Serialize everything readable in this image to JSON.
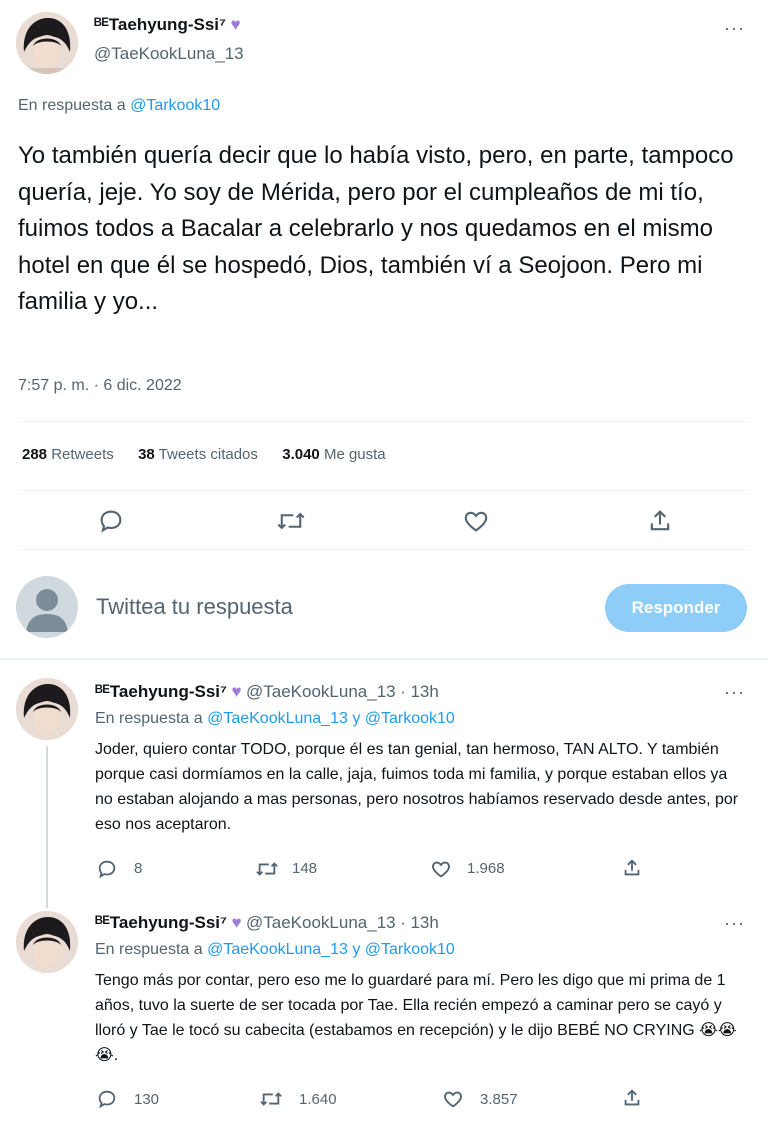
{
  "main_tweet": {
    "author_name": "ᴮᴱTaehyung-Ssi⁷",
    "handle": "@TaeKookLuna_13",
    "reply_prefix": "En respuesta a",
    "reply_to": "@Tarkook10",
    "text": "Yo también quería decir que lo había visto, pero, en parte, tampoco quería, jeje. Yo soy de Mérida, pero por el cumpleaños de mi tío, fuimos todos a Bacalar a celebrarlo y nos quedamos en el mismo hotel en que él se hospedó, Dios, también ví a Seojoon. Pero mi familia y yo...",
    "timestamp": "7:57 p. m. · 6 dic. 2022",
    "stats": {
      "retweets_count": "288",
      "retweets_label": "Retweets",
      "quotes_count": "38",
      "quotes_label": "Tweets citados",
      "likes_count": "3.040",
      "likes_label": "Me gusta"
    }
  },
  "compose": {
    "placeholder": "Twittea tu respuesta",
    "button_label": "Responder"
  },
  "replies": [
    {
      "author_name": "ᴮᴱTaehyung-Ssi⁷",
      "handle": "@TaeKookLuna_13",
      "time": "· 13h",
      "reply_prefix": "En respuesta a",
      "reply_to": "@TaeKookLuna_13 y @Tarkook10",
      "text": "Joder, quiero contar TODO, porque él es tan genial, tan hermoso, TAN ALTO. Y también porque casi dormíamos en la calle, jaja, fuimos toda mi familia, y porque estaban ellos ya no estaban alojando a mas personas, pero nosotros habíamos reservado desde antes, por eso nos aceptaron.",
      "replies_count": "8",
      "retweets_count": "148",
      "likes_count": "1.968"
    },
    {
      "author_name": "ᴮᴱTaehyung-Ssi⁷",
      "handle": "@TaeKookLuna_13",
      "time": "· 13h",
      "reply_prefix": "En respuesta a",
      "reply_to": "@TaeKookLuna_13 y @Tarkook10",
      "text": "Tengo más por contar, pero eso me lo guardaré para mí. Pero les digo que mi prima de 1 años, tuvo la suerte de ser tocada por Tae. Ella recién empezó a caminar pero se cayó y lloró y Tae le tocó su cabecita (estabamos en recepción) y le dijo BEBÉ NO CRYING 😭😭😭.",
      "replies_count": "130",
      "retweets_count": "1.640",
      "likes_count": "3.857"
    }
  ],
  "colors": {
    "accent": "#1d9bf0",
    "button_disabled": "#8ecdf8",
    "heart_emoji": "#a07cd8",
    "secondary_text": "#536471"
  }
}
